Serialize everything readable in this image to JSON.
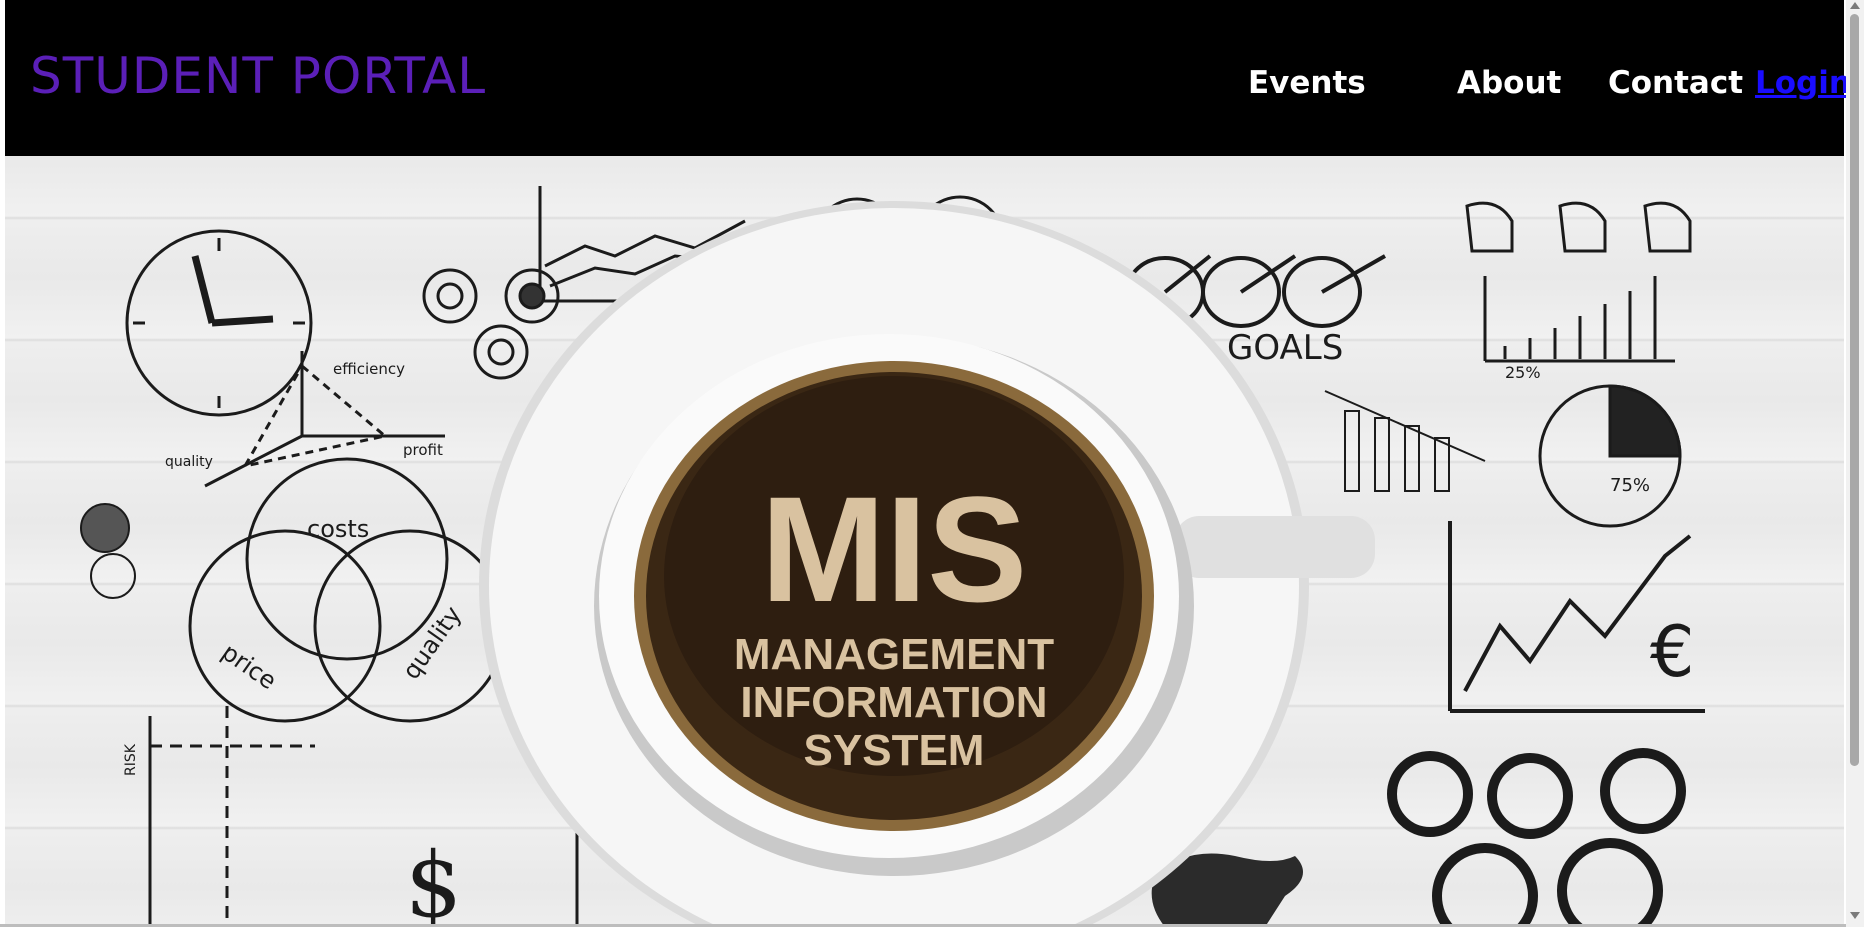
{
  "header": {
    "brand": "STUDENT PORTAL",
    "nav": {
      "events": "Events",
      "about": "About",
      "contact": "Contact",
      "login": "Login"
    }
  },
  "hero": {
    "image_text": {
      "title": "MIS",
      "line1": "MANAGEMENT",
      "line2": "INFORMATION",
      "line3": "SYSTEM"
    },
    "sketch_labels": {
      "goals": "GOALS",
      "costs": "costs",
      "price": "price",
      "quality": "quality",
      "efficiency": "efficiency",
      "quality_axis": "quality",
      "profit": "profit",
      "pct_25": "25%",
      "pct_75": "75%",
      "risk": "RISK",
      "dollar": "$",
      "euro": "€"
    }
  },
  "colors": {
    "navbar_bg": "#000000",
    "brand": "#5b1fb8",
    "nav_text": "#ffffff",
    "login_link": "#1a0dff"
  }
}
